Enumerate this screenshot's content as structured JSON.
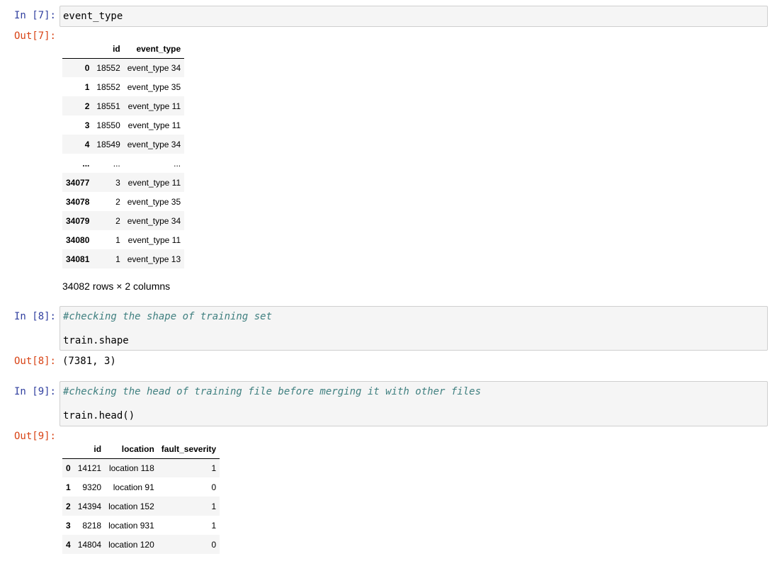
{
  "cell7": {
    "in_prompt": "In [7]:",
    "code": "event_type",
    "out_prompt": "Out[7]:",
    "table": {
      "columns": [
        "",
        "id",
        "event_type"
      ],
      "rows": [
        [
          "0",
          "18552",
          "event_type 34"
        ],
        [
          "1",
          "18552",
          "event_type 35"
        ],
        [
          "2",
          "18551",
          "event_type 11"
        ],
        [
          "3",
          "18550",
          "event_type 11"
        ],
        [
          "4",
          "18549",
          "event_type 34"
        ],
        [
          "...",
          "...",
          "..."
        ],
        [
          "34077",
          "3",
          "event_type 11"
        ],
        [
          "34078",
          "2",
          "event_type 35"
        ],
        [
          "34079",
          "2",
          "event_type 34"
        ],
        [
          "34080",
          "1",
          "event_type 11"
        ],
        [
          "34081",
          "1",
          "event_type 13"
        ]
      ]
    },
    "rows_info": "34082 rows × 2 columns"
  },
  "cell8": {
    "in_prompt": "In [8]:",
    "comment": "#checking the shape of training set",
    "code": "train.shape",
    "out_prompt": "Out[8]:",
    "output": "(7381, 3)"
  },
  "cell9": {
    "in_prompt": "In [9]:",
    "comment": "#checking the head of training file before merging it with other files",
    "code": "train.head()",
    "out_prompt": "Out[9]:",
    "table": {
      "columns": [
        "",
        "id",
        "location",
        "fault_severity"
      ],
      "rows": [
        [
          "0",
          "14121",
          "location 118",
          "1"
        ],
        [
          "1",
          "9320",
          "location 91",
          "0"
        ],
        [
          "2",
          "14394",
          "location 152",
          "1"
        ],
        [
          "3",
          "8218",
          "location 931",
          "1"
        ],
        [
          "4",
          "14804",
          "location 120",
          "0"
        ]
      ]
    }
  }
}
